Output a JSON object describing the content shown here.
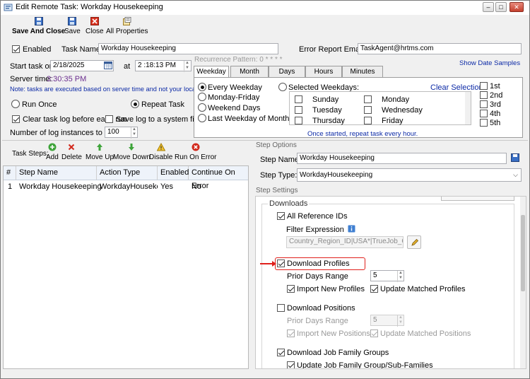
{
  "window": {
    "title": "Edit Remote Task: Workday Housekeeping",
    "min_icon": "minimize-icon",
    "max_icon": "restore-icon",
    "close_icon": "close-icon"
  },
  "toolbar": {
    "save_and_close": "Save And Close",
    "save": "Save",
    "close": "Close",
    "all_properties": "All Properties"
  },
  "task": {
    "enabled_label": "Enabled",
    "task_name_label": "Task Name:",
    "task_name": "Workday Housekeeping",
    "report_email_label": "Error Report Email:",
    "report_email": "TaskAgent@hrtms.com",
    "start_label": "Start task on",
    "start_date": "2/18/2025",
    "at_label": "at",
    "start_time": "2 :18:13 PM",
    "server_time_label": "Server time:",
    "server_time": "3:30:35 PM",
    "note": "Note: tasks are executed based on server time and not your local time!",
    "run_once": "Run Once",
    "repeat_task": "Repeat Task",
    "clear_log": "Clear task log before each run",
    "save_log": "Save log to a system file",
    "log_instances_label": "Number of log instances to keep:",
    "log_instances": "100"
  },
  "recurrence": {
    "label": "Recurrence Pattern: 0 * * * *",
    "show_samples": "Show Date Samples",
    "tabs": [
      "Weekday",
      "Month",
      "Days",
      "Hours",
      "Minutes"
    ],
    "every_weekday": "Every Weekday",
    "monday_friday": "Monday-Friday",
    "weekend_days": "Weekend Days",
    "last_weekday": "Last Weekday of Month",
    "selected_weekdays": "Selected Weekdays:",
    "clear_selection": "Clear Selection",
    "days_col1": [
      "Sunday",
      "Tuesday",
      "Thursday"
    ],
    "days_col2": [
      "Monday",
      "Wednesday",
      "Friday"
    ],
    "ordinals": [
      "1st",
      "2nd",
      "3rd",
      "4th",
      "5th"
    ],
    "footer": "Once started, repeat task every hour."
  },
  "steps_toolbar": {
    "label": "Task Steps:",
    "add": "Add",
    "delete": "Delete",
    "move_up": "Move Up",
    "move_down": "Move Down",
    "disable": "Disable",
    "run_on_error": "Run On Error"
  },
  "steps_grid": {
    "headers": [
      "#",
      "Step Name",
      "Action Type",
      "Enabled",
      "Continue On Error"
    ],
    "row": {
      "num": "1",
      "name": "Workday Housekeeping",
      "action": "WorkdayHousekeepin",
      "enabled": "Yes",
      "continue": "No"
    }
  },
  "step_options": {
    "header": "Step Options",
    "name_label": "Step Name:",
    "name": "Workday Housekeeping",
    "type_label": "Step Type:",
    "type": "WorkdayHousekeeping"
  },
  "step_settings": {
    "header": "Step Settings",
    "downloads": "Downloads",
    "all_reference_ids": "All Reference IDs",
    "filter_expression": "Filter Expression",
    "filter_value": "Country_Region_ID|USA*|TrueJob_Cl",
    "download_profiles": "Download Profiles",
    "prior_days_range": "Prior Days Range",
    "profiles_days": "5",
    "import_new_profiles": "Import New Profiles",
    "update_matched_profiles": "Update Matched Profiles",
    "download_positions": "Download Positions",
    "positions_days": "5",
    "import_new_positions": "Import New Positions",
    "update_matched_positions": "Update Matched Positions",
    "download_job_family_groups": "Download Job Family Groups",
    "update_job_family": "Update Job Family Group/Sub-Families"
  },
  "colors": {
    "highlight": "#e0201c",
    "link": "#0c2aa6",
    "server_time": "#6b2e8f"
  }
}
